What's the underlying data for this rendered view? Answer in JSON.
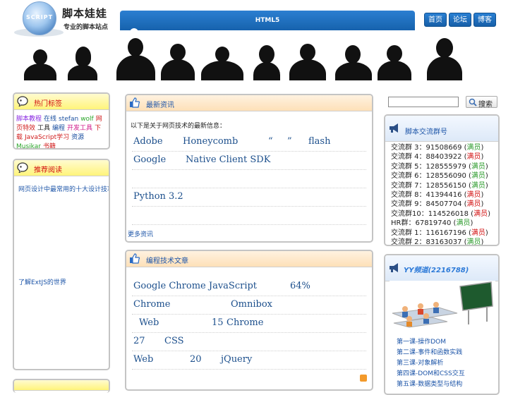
{
  "header": {
    "logo_text": "脚本娃娃",
    "logo_badge": "SCRIPT",
    "slogan": "专业的脚本站点",
    "nav_title": "HTML5",
    "buttons": [
      "首页",
      "论坛",
      "博客"
    ]
  },
  "left": {
    "box1": {
      "title": "热门标签",
      "tags": [
        {
          "text": "脚本教程",
          "color": "#8a2be2"
        },
        {
          "text": "在线",
          "color": "#1a4fa0"
        },
        {
          "text": "stefan",
          "color": "#1a4fa0"
        },
        {
          "text": "wolf",
          "color": "#2aa52a"
        },
        {
          "text": "网页特效",
          "color": "#d01a1a"
        },
        {
          "text": "工具",
          "color": "#222222"
        },
        {
          "text": "编程",
          "color": "#1a4fa0"
        },
        {
          "text": "开发工具",
          "color": "#d01a8a"
        },
        {
          "text": "下载",
          "color": "#d01a1a"
        },
        {
          "text": "JavaScript学习",
          "color": "#d01a1a"
        },
        {
          "text": "资源",
          "color": "#1a4fa0"
        },
        {
          "text": "Musikar",
          "color": "#2aa52a"
        },
        {
          "text": "书籍",
          "color": "#d01a1a"
        }
      ]
    },
    "box2": {
      "title": "推荐阅读",
      "link1": "网页设计中最常用的十大设计技巧",
      "link2": "了解ExtJS的世界"
    }
  },
  "center": {
    "box1": {
      "title": "最新资讯",
      "intro": "以下是关于网页技术的最新信息：",
      "rows": [
        [
          "Adobe",
          "Honeycomb",
          "“",
          "”",
          "flash"
        ],
        [
          "Google",
          "Native Client SDK"
        ],
        [],
        [
          "Python 3.2"
        ]
      ],
      "more": "更多资讯"
    },
    "box2": {
      "title": "编程技术文章",
      "rows": [
        [
          "Google Chrome JavaScript",
          "64%"
        ],
        [
          "Chrome",
          "Omnibox"
        ],
        [
          "Web",
          "15",
          "Chrome"
        ],
        [
          "27",
          "CSS"
        ],
        [
          "Web",
          "20",
          "jQuery"
        ]
      ]
    }
  },
  "right": {
    "search_placeholder": "",
    "search_button": "搜索",
    "qq": {
      "title": "脚本交流群号",
      "groups": [
        {
          "label": "交流群 3：",
          "num": "91508669",
          "status": "满员",
          "state": "green"
        },
        {
          "label": "交流群 4：",
          "num": "88403922",
          "status": "满员",
          "state": "red"
        },
        {
          "label": "交流群 5：",
          "num": "128555979",
          "status": "满员",
          "state": "green"
        },
        {
          "label": "交流群 6：",
          "num": "128556090",
          "status": "满员",
          "state": "green"
        },
        {
          "label": "交流群 7：",
          "num": "128556150",
          "status": "满员",
          "state": "green"
        },
        {
          "label": "交流群 8：",
          "num": "41394416",
          "status": "满员",
          "state": "red"
        },
        {
          "label": "交流群 9：",
          "num": "84507704",
          "status": "满员",
          "state": "red"
        },
        {
          "label": "交流群10：",
          "num": "114526018",
          "status": "满员",
          "state": "red"
        },
        {
          "label": "HR群：",
          "num": "67819740",
          "status": "满员",
          "state": "green"
        },
        {
          "label": "交流群 1：",
          "num": "116167196",
          "status": "满员",
          "state": "red"
        },
        {
          "label": "交流群 2：",
          "num": "83163037",
          "status": "满员",
          "state": "green"
        }
      ]
    },
    "yy": {
      "title": "YY频道(2216788)",
      "tutorials": [
        "第一课-操作DOM",
        "第二课-事件和函数实践",
        "第三课-对象解析",
        "第四课-DOM和CSS交互",
        "第五课-数据类型与结构"
      ]
    }
  },
  "colors": {
    "nav_blue": "#1a6fc3",
    "panel_border": "#c4c4c4",
    "link_blue": "#1c4f8c"
  }
}
